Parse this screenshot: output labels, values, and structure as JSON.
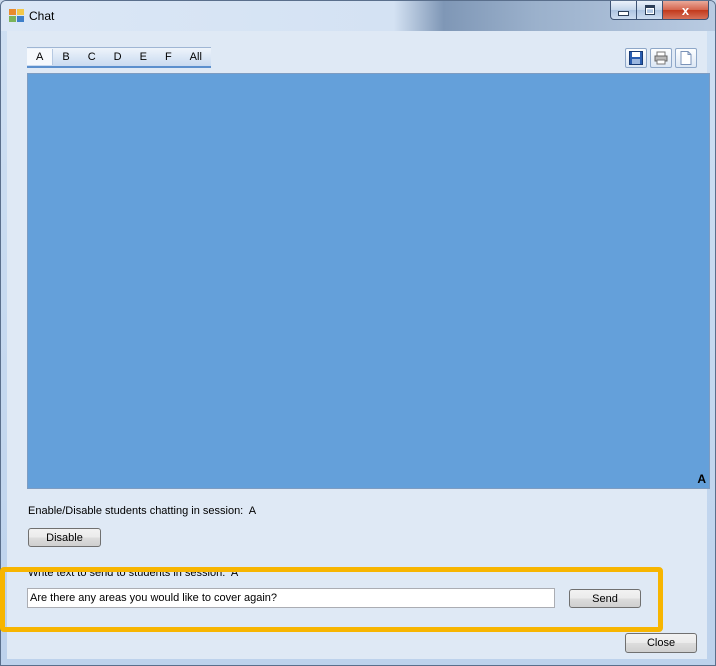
{
  "window": {
    "title": "Chat",
    "controls": {
      "minimize": "minimize",
      "maximize": "maximize",
      "close": "x"
    }
  },
  "tabs": [
    {
      "label": "A",
      "active": true
    },
    {
      "label": "B"
    },
    {
      "label": "C"
    },
    {
      "label": "D"
    },
    {
      "label": "E"
    },
    {
      "label": "F"
    },
    {
      "label": "All"
    }
  ],
  "toolbar": {
    "icons": [
      "save-icon",
      "print-icon",
      "new-document-icon"
    ]
  },
  "chat": {
    "background": "#64a0da",
    "session_marker": "A"
  },
  "enable_section": {
    "label": "Enable/Disable students chatting in session:",
    "session": "A",
    "disable_button": "Disable"
  },
  "send_section": {
    "label": "Write text to send to students in session:",
    "session": "A",
    "message_value": "Are there any areas you would like to cover again?",
    "send_button": "Send"
  },
  "footer": {
    "close_button": "Close"
  },
  "colors": {
    "highlight": "#f7b500",
    "chat_area": "#64a0da"
  }
}
